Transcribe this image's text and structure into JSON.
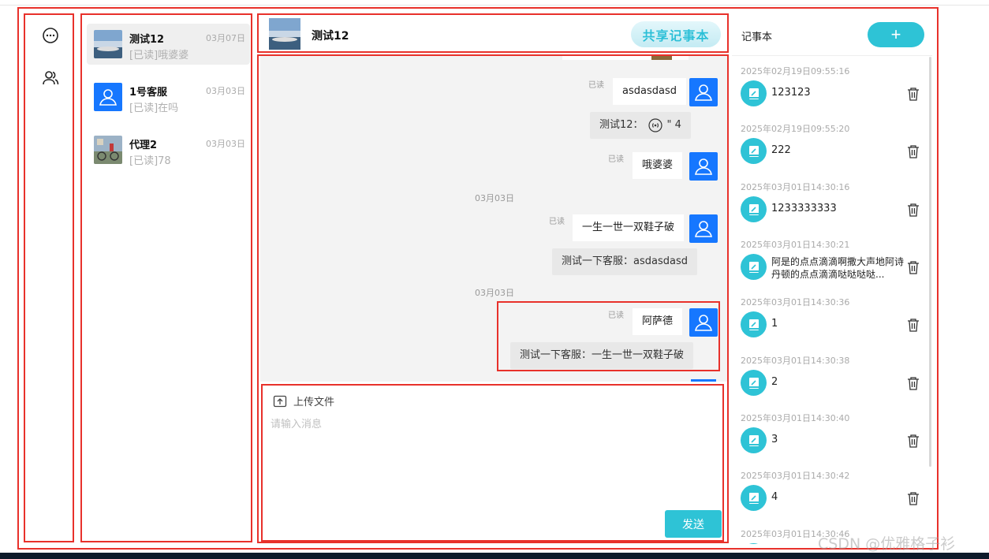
{
  "rail": {
    "items": [
      {
        "icon": "chat-bubble-icon"
      },
      {
        "icon": "contacts-icon"
      }
    ]
  },
  "conversations": [
    {
      "name": "测试12",
      "date": "03月07日",
      "preview": "[已读]哦婆婆",
      "avatar": "landscape-photo",
      "active": true
    },
    {
      "name": "1号客服",
      "date": "03月03日",
      "preview": "[已读]在吗",
      "avatar": "default-user",
      "active": false
    },
    {
      "name": "代理2",
      "date": "03月03日",
      "preview": "[已读]78",
      "avatar": "bike-photo",
      "active": false
    }
  ],
  "chat": {
    "title": "测试12",
    "share_label": "共享记事本",
    "read_label": "已读",
    "messages": [
      {
        "text": "asdasdasd"
      },
      {
        "sys_prefix": "测试12：",
        "sys_suffix": "\" 4"
      },
      {
        "text": "哦婆婆"
      },
      {
        "date": "03月03日"
      },
      {
        "text": "一生一世一双鞋子破"
      },
      {
        "sys": "测试一下客服：asdasdasd"
      },
      {
        "date": "03月03日"
      },
      {
        "text": "阿萨德"
      },
      {
        "sys": "测试一下客服：一生一世一双鞋子破"
      }
    ]
  },
  "input": {
    "upload_label": "上传文件",
    "placeholder": "请输入消息",
    "send_label": "发送"
  },
  "notes": {
    "title": "记事本",
    "add_label": "+",
    "items": [
      {
        "time": "2025年02月19日09:55:16",
        "text": "123123"
      },
      {
        "time": "2025年02月19日09:55:20",
        "text": "222"
      },
      {
        "time": "2025年03月01日14:30:16",
        "text": "1233333333"
      },
      {
        "time": "2025年03月01日14:30:21",
        "text": "阿是的点点滴滴啊撒大声地阿诗丹顿的点点滴滴哒哒哒哒..."
      },
      {
        "time": "2025年03月01日14:30:36",
        "text": "1"
      },
      {
        "time": "2025年03月01日14:30:38",
        "text": "2"
      },
      {
        "time": "2025年03月01日14:30:40",
        "text": "3"
      },
      {
        "time": "2025年03月01日14:30:42",
        "text": "4"
      },
      {
        "time": "2025年03月01日14:30:46",
        "text": ""
      }
    ]
  },
  "watermark": "CSDN @优雅格子衫",
  "colors": {
    "accent": "#2ec3d6",
    "avatar_blue": "#1677ff",
    "annotation_red": "#e8312b"
  }
}
